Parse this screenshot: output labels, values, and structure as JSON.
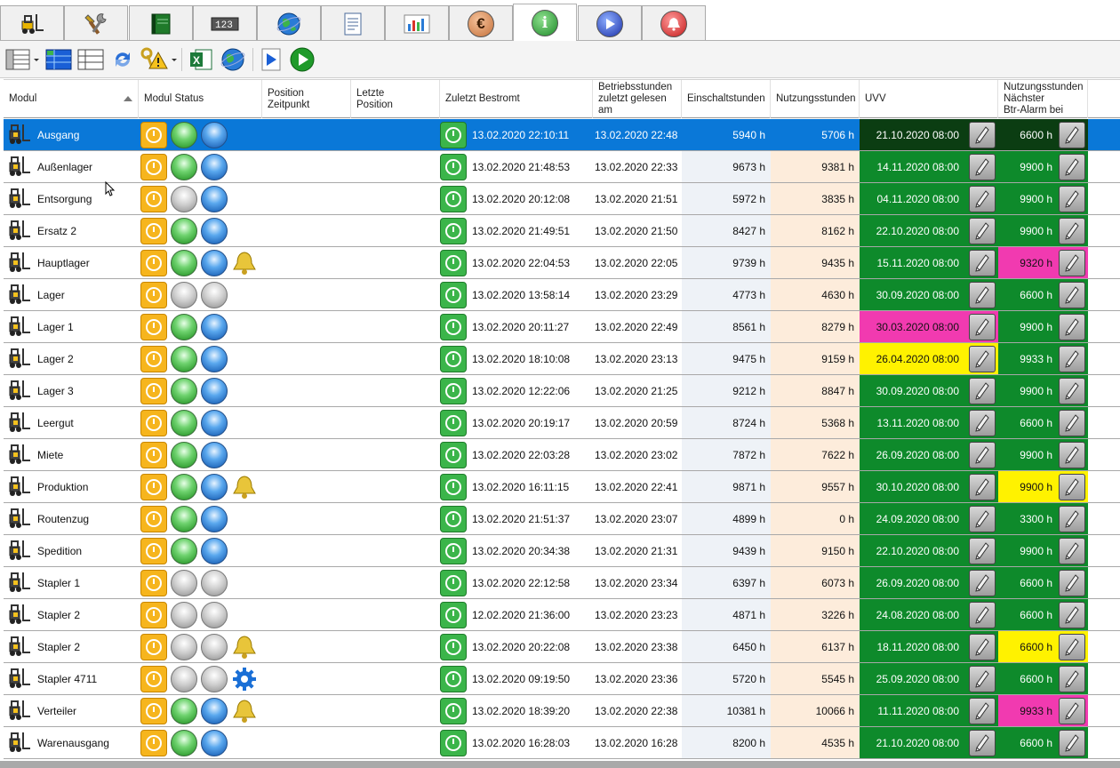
{
  "tabs": [
    {
      "icon": "forklift-icon",
      "active": false
    },
    {
      "icon": "tools-icon",
      "active": false
    },
    {
      "icon": "book-icon",
      "active": false
    },
    {
      "icon": "counter-icon",
      "active": false
    },
    {
      "icon": "globe-icon",
      "active": false
    },
    {
      "icon": "document-icon",
      "active": false
    },
    {
      "icon": "bar-chart-icon",
      "active": false
    },
    {
      "icon": "euro-icon",
      "active": false,
      "glyph": "€"
    },
    {
      "icon": "info-icon",
      "active": true,
      "glyph": "i"
    },
    {
      "icon": "play-icon",
      "active": false
    },
    {
      "icon": "alarm-bell-icon",
      "active": false
    }
  ],
  "toolbar": [
    {
      "icon": "columns-dropdown-icon"
    },
    {
      "icon": "grid-view-icon"
    },
    {
      "icon": "list-view-icon"
    },
    {
      "icon": "refresh-icon"
    },
    {
      "icon": "key-warning-dropdown-icon"
    },
    {
      "icon": "excel-export-icon"
    },
    {
      "icon": "web-export-icon"
    },
    {
      "icon": "play-icon"
    },
    {
      "icon": "start-icon"
    }
  ],
  "columns": {
    "modul": "Modul",
    "status": "Modul Status",
    "pos1": "Position",
    "pos2": "Zeitpunkt",
    "last1": "Letzte",
    "last2": "Position",
    "bestromt": "Zuletzt Bestromt",
    "betr1": "Betriebsstunden",
    "betr2": "zuletzt gelesen am",
    "ein": "Einschaltstunden",
    "nutz": "Nutzungsstunden",
    "uvv": "UVV",
    "btr1": "Nutzungsstunden",
    "btr2": "Nächster",
    "btr3": "Btr-Alarm bei"
  },
  "colors": {
    "selection": "#0a78d8",
    "ok_green": "#0e8a2b",
    "alarm_pink": "#f13ab0",
    "warning_yellow": "#fff200"
  },
  "rows": [
    {
      "name": "Ausgang",
      "status": [
        "orange",
        "green",
        "blue"
      ],
      "extra": "",
      "bestromt": "13.02.2020 22:10:11",
      "gelesen": "13.02.2020 22:48",
      "ein": "5940 h",
      "nutz": "5706 h",
      "uvv": "21.10.2020 08:00",
      "uvv_state": "dark",
      "btr": "6600 h",
      "btr_state": "dark",
      "selected": true
    },
    {
      "name": "Außenlager",
      "status": [
        "orange",
        "green",
        "blue"
      ],
      "extra": "",
      "bestromt": "13.02.2020 21:48:53",
      "gelesen": "13.02.2020 22:33",
      "ein": "9673 h",
      "nutz": "9381 h",
      "uvv": "14.11.2020 08:00",
      "uvv_state": "green",
      "btr": "9900 h",
      "btr_state": "green"
    },
    {
      "name": "Entsorgung",
      "status": [
        "orange",
        "grey",
        "blue"
      ],
      "extra": "",
      "bestromt": "13.02.2020 20:12:08",
      "gelesen": "13.02.2020 21:51",
      "ein": "5972 h",
      "nutz": "3835 h",
      "uvv": "04.11.2020 08:00",
      "uvv_state": "green",
      "btr": "9900 h",
      "btr_state": "green"
    },
    {
      "name": "Ersatz 2",
      "status": [
        "orange",
        "green",
        "blue"
      ],
      "extra": "",
      "bestromt": "13.02.2020 21:49:51",
      "gelesen": "13.02.2020 21:50",
      "ein": "8427 h",
      "nutz": "8162 h",
      "uvv": "22.10.2020 08:00",
      "uvv_state": "green",
      "btr": "9900 h",
      "btr_state": "green"
    },
    {
      "name": "Hauptlager",
      "status": [
        "orange",
        "green",
        "blue"
      ],
      "extra": "bell",
      "bestromt": "13.02.2020 22:04:53",
      "gelesen": "13.02.2020 22:05",
      "ein": "9739 h",
      "nutz": "9435 h",
      "uvv": "15.11.2020 08:00",
      "uvv_state": "green",
      "btr": "9320 h",
      "btr_state": "pink"
    },
    {
      "name": "Lager",
      "status": [
        "orange",
        "grey",
        "grey"
      ],
      "extra": "",
      "bestromt": "13.02.2020 13:58:14",
      "gelesen": "13.02.2020 23:29",
      "ein": "4773 h",
      "nutz": "4630 h",
      "uvv": "30.09.2020 08:00",
      "uvv_state": "green",
      "btr": "6600 h",
      "btr_state": "green"
    },
    {
      "name": "Lager 1",
      "status": [
        "orange",
        "green",
        "blue"
      ],
      "extra": "",
      "bestromt": "13.02.2020 20:11:27",
      "gelesen": "13.02.2020 22:49",
      "ein": "8561 h",
      "nutz": "8279 h",
      "uvv": "30.03.2020 08:00",
      "uvv_state": "pink",
      "btr": "9900 h",
      "btr_state": "green"
    },
    {
      "name": "Lager 2",
      "status": [
        "orange",
        "green",
        "blue"
      ],
      "extra": "",
      "bestromt": "13.02.2020 18:10:08",
      "gelesen": "13.02.2020 23:13",
      "ein": "9475 h",
      "nutz": "9159 h",
      "uvv": "26.04.2020 08:00",
      "uvv_state": "yellow",
      "btr": "9933 h",
      "btr_state": "green"
    },
    {
      "name": "Lager 3",
      "status": [
        "orange",
        "green",
        "blue"
      ],
      "extra": "",
      "bestromt": "13.02.2020 12:22:06",
      "gelesen": "13.02.2020 21:25",
      "ein": "9212 h",
      "nutz": "8847 h",
      "uvv": "30.09.2020 08:00",
      "uvv_state": "green",
      "btr": "9900 h",
      "btr_state": "green"
    },
    {
      "name": "Leergut",
      "status": [
        "orange",
        "green",
        "blue"
      ],
      "extra": "",
      "bestromt": "13.02.2020 20:19:17",
      "gelesen": "13.02.2020 20:59",
      "ein": "8724 h",
      "nutz": "5368 h",
      "uvv": "13.11.2020 08:00",
      "uvv_state": "green",
      "btr": "6600 h",
      "btr_state": "green"
    },
    {
      "name": "Miete",
      "status": [
        "orange",
        "green",
        "blue"
      ],
      "extra": "",
      "bestromt": "13.02.2020 22:03:28",
      "gelesen": "13.02.2020 23:02",
      "ein": "7872 h",
      "nutz": "7622 h",
      "uvv": "26.09.2020 08:00",
      "uvv_state": "green",
      "btr": "9900 h",
      "btr_state": "green"
    },
    {
      "name": "Produktion",
      "status": [
        "orange",
        "green",
        "blue"
      ],
      "extra": "bell",
      "bestromt": "13.02.2020 16:11:15",
      "gelesen": "13.02.2020 22:41",
      "ein": "9871 h",
      "nutz": "9557 h",
      "uvv": "30.10.2020 08:00",
      "uvv_state": "green",
      "btr": "9900 h",
      "btr_state": "yellow"
    },
    {
      "name": "Routenzug",
      "status": [
        "orange",
        "green",
        "blue"
      ],
      "extra": "",
      "bestromt": "13.02.2020 21:51:37",
      "gelesen": "13.02.2020 23:07",
      "ein": "4899 h",
      "nutz": "0 h",
      "uvv": "24.09.2020 08:00",
      "uvv_state": "green",
      "btr": "3300 h",
      "btr_state": "green"
    },
    {
      "name": "Spedition",
      "status": [
        "orange",
        "green",
        "blue"
      ],
      "extra": "",
      "bestromt": "13.02.2020 20:34:38",
      "gelesen": "13.02.2020 21:31",
      "ein": "9439 h",
      "nutz": "9150 h",
      "uvv": "22.10.2020 08:00",
      "uvv_state": "green",
      "btr": "9900 h",
      "btr_state": "green"
    },
    {
      "name": "Stapler 1",
      "status": [
        "orange",
        "grey",
        "grey"
      ],
      "extra": "",
      "bestromt": "13.02.2020 22:12:58",
      "gelesen": "13.02.2020 23:34",
      "ein": "6397 h",
      "nutz": "6073 h",
      "uvv": "26.09.2020 08:00",
      "uvv_state": "green",
      "btr": "6600 h",
      "btr_state": "green"
    },
    {
      "name": "Stapler 2",
      "status": [
        "orange",
        "grey",
        "grey"
      ],
      "extra": "",
      "bestromt": "12.02.2020 21:36:00",
      "gelesen": "13.02.2020 23:23",
      "ein": "4871 h",
      "nutz": "3226 h",
      "uvv": "24.08.2020 08:00",
      "uvv_state": "green",
      "btr": "6600 h",
      "btr_state": "green"
    },
    {
      "name": "Stapler 2",
      "status": [
        "orange",
        "grey",
        "grey"
      ],
      "extra": "bell",
      "bestromt": "13.02.2020 20:22:08",
      "gelesen": "13.02.2020 23:38",
      "ein": "6450 h",
      "nutz": "6137 h",
      "uvv": "18.11.2020 08:00",
      "uvv_state": "green",
      "btr": "6600 h",
      "btr_state": "yellow"
    },
    {
      "name": "Stapler 4711",
      "status": [
        "orange",
        "grey",
        "grey"
      ],
      "extra": "gear",
      "bestromt": "13.02.2020 09:19:50",
      "gelesen": "13.02.2020 23:36",
      "ein": "5720 h",
      "nutz": "5545 h",
      "uvv": "25.09.2020 08:00",
      "uvv_state": "green",
      "btr": "6600 h",
      "btr_state": "green"
    },
    {
      "name": "Verteiler",
      "status": [
        "orange",
        "green",
        "blue"
      ],
      "extra": "bell",
      "bestromt": "13.02.2020 18:39:20",
      "gelesen": "13.02.2020 22:38",
      "ein": "10381 h",
      "nutz": "10066 h",
      "uvv": "11.11.2020 08:00",
      "uvv_state": "green",
      "btr": "9933 h",
      "btr_state": "pink"
    },
    {
      "name": "Warenausgang",
      "status": [
        "orange",
        "green",
        "blue"
      ],
      "extra": "",
      "bestromt": "13.02.2020 16:28:03",
      "gelesen": "13.02.2020 16:28",
      "ein": "8200 h",
      "nutz": "4535 h",
      "uvv": "21.10.2020 08:00",
      "uvv_state": "green",
      "btr": "6600 h",
      "btr_state": "green"
    }
  ]
}
